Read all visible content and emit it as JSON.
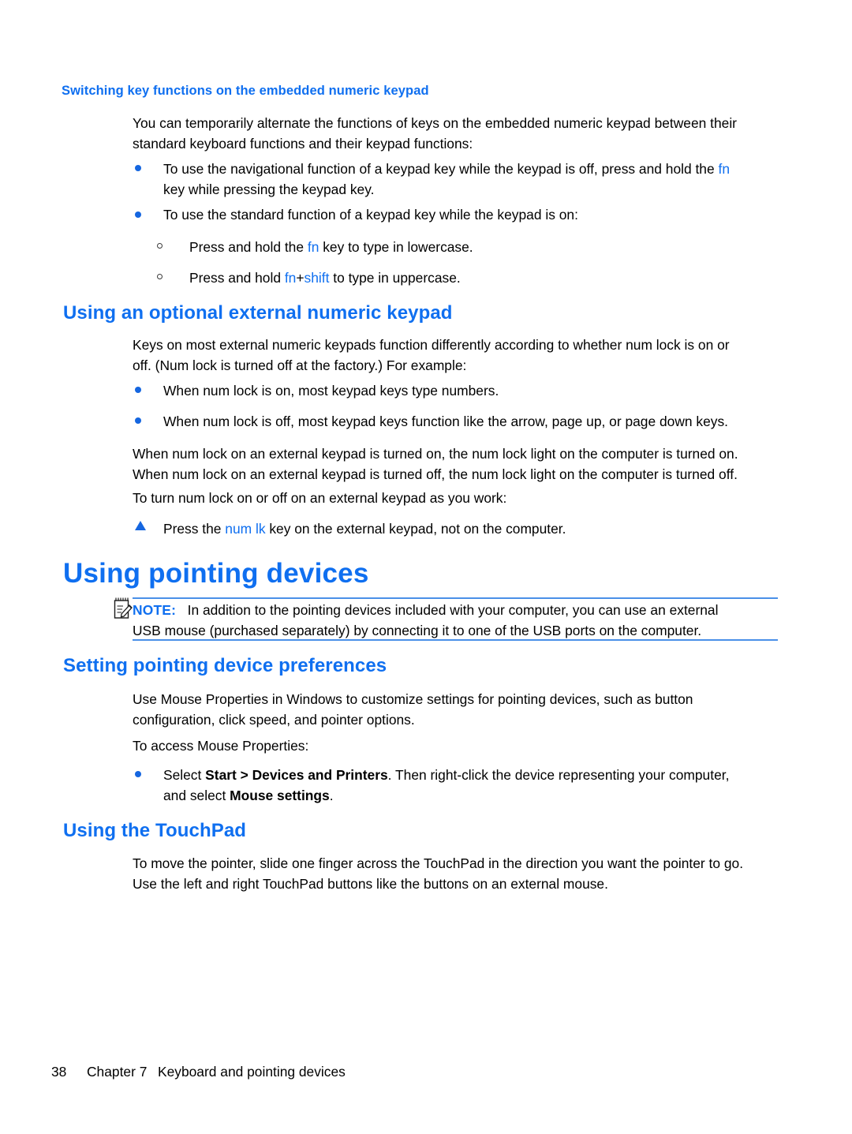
{
  "page": {
    "background": "#ffffff",
    "accent_blue": "#0f6ff0",
    "rule_blue": "#4a90e8"
  },
  "sections": {
    "switching": {
      "heading": "Switching key functions on the embedded numeric keypad",
      "intro_line1": "You can temporarily alternate the functions of keys on the embedded numeric keypad between their",
      "intro_line2": "standard keyboard functions and their keypad functions:",
      "bullet1_pre": "To use the navigational function of a keypad key while the keypad is off, press and hold the ",
      "bullet1_key": "fn",
      "bullet1_line2": "key while pressing the keypad key.",
      "bullet2": "To use the standard function of a keypad key while the keypad is on:",
      "sub1_pre": "Press and hold the ",
      "sub1_key": "fn",
      "sub1_post": " key to type in lowercase.",
      "sub2_pre": "Press and hold ",
      "sub2_key1": "fn",
      "sub2_plus": "+",
      "sub2_key2": "shift",
      "sub2_post": " to type in uppercase."
    },
    "external_keypad": {
      "heading": "Using an optional external numeric keypad",
      "intro_line1": "Keys on most external numeric keypads function differently according to whether num lock is on or",
      "intro_line2": "off. (Num lock is turned off at the factory.) For example:",
      "bullet1": "When num lock is on, most keypad keys type numbers.",
      "bullet2": "When num lock is off, most keypad keys function like the arrow, page up, or page down keys.",
      "para_line1": "When num lock on an external keypad is turned on, the num lock light on the computer is turned on.",
      "para_line2": "When num lock on an external keypad is turned off, the num lock light on the computer is turned off.",
      "para2": "To turn num lock on or off on an external keypad as you work:",
      "step_pre": "Press the ",
      "step_key": "num lk",
      "step_post": " key on the external keypad, not on the computer."
    },
    "pointing_devices": {
      "heading": "Using pointing devices",
      "note_label": "NOTE:",
      "note_line1": "In addition to the pointing devices included with your computer, you can use an external",
      "note_line2": "USB mouse (purchased separately) by connecting it to one of the USB ports on the computer."
    },
    "preferences": {
      "heading": "Setting pointing device preferences",
      "para_line1": "Use Mouse Properties in Windows to customize settings for pointing devices, such as button",
      "para_line2": "configuration, click speed, and pointer options.",
      "para2": "To access Mouse Properties:",
      "bullet_pre": "Select ",
      "bullet_bold1": "Start > Devices and Printers",
      "bullet_mid": ". Then right-click the device representing your computer,",
      "bullet_line2_pre": "and select ",
      "bullet_bold2": "Mouse settings",
      "bullet_line2_post": "."
    },
    "touchpad": {
      "heading": "Using the TouchPad",
      "para_line1": "To move the pointer, slide one finger across the TouchPad in the direction you want the pointer to go.",
      "para_line2": "Use the left and right TouchPad buttons like the buttons on an external mouse."
    }
  },
  "footer": {
    "page_number": "38",
    "chapter": "Chapter 7",
    "title": "Keyboard and pointing devices"
  }
}
